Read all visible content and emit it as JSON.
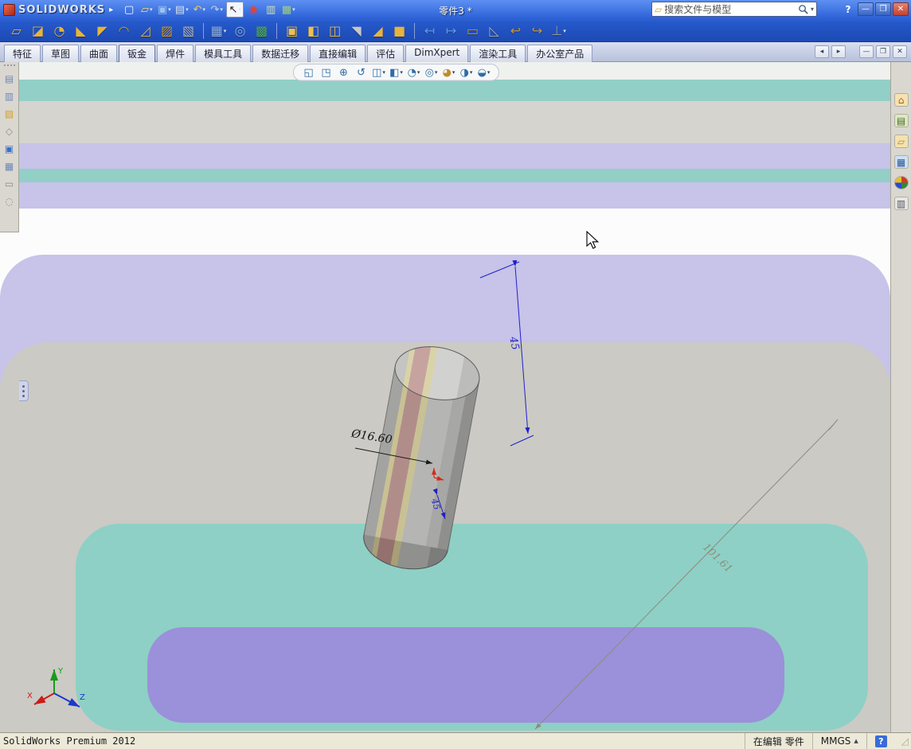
{
  "icons": {
    "dropdown": "▾",
    "chevron_right": "▸",
    "caret_up": "▲",
    "folder": "▱",
    "grip": "◿"
  },
  "window": {
    "brand": "SOLIDWORKS",
    "title": "零件3 *",
    "search_placeholder": "搜索文件与模型",
    "controls": {
      "help": "?",
      "minimize": "—",
      "maximize": "❐",
      "close": "✕"
    }
  },
  "titlebar_tools": [
    {
      "name": "new-document",
      "glyph": "▢",
      "color": "#ffffff"
    },
    {
      "name": "open-document",
      "glyph": "▱",
      "color": "#ffd86b",
      "dd": true
    },
    {
      "name": "save",
      "glyph": "▣",
      "color": "#9cc3f0",
      "dd": true
    },
    {
      "name": "print",
      "glyph": "▤",
      "color": "#d8e0ec",
      "dd": true
    },
    {
      "name": "undo",
      "glyph": "↶",
      "color": "#f6c94c",
      "dd": true
    },
    {
      "name": "redo",
      "glyph": "↷",
      "color": "#c9ced8",
      "dd": true
    },
    {
      "name": "select-tool",
      "glyph": "↖",
      "color": "#222222",
      "boxed": true,
      "dd": true
    },
    {
      "name": "rebuild",
      "glyph": "◉",
      "color": "#e04338"
    },
    {
      "name": "file-properties",
      "glyph": "▥",
      "color": "#cfe0b8"
    },
    {
      "name": "table",
      "glyph": "▦",
      "color": "#9fd089",
      "dd": true
    }
  ],
  "sheet_metal_tools": [
    {
      "name": "base-flange",
      "glyph": "▱",
      "color": "#e8b33c"
    },
    {
      "name": "convert-to-sheet-metal",
      "glyph": "◪",
      "color": "#e8b33c"
    },
    {
      "name": "lofted-bend",
      "glyph": "◔",
      "color": "#e8b33c"
    },
    {
      "name": "edge-flange",
      "glyph": "◣",
      "color": "#e8b33c"
    },
    {
      "name": "miter-flange",
      "glyph": "◤",
      "color": "#e8b33c"
    },
    {
      "name": "hem",
      "glyph": "◠",
      "color": "#cf952a"
    },
    {
      "name": "jog",
      "glyph": "◿",
      "color": "#e8b33c"
    },
    {
      "name": "sketched-bend",
      "glyph": "▨",
      "color": "#cf952a"
    },
    {
      "name": "cross-break",
      "glyph": "▧",
      "color": "#b8b8b8"
    },
    {
      "sep": true
    },
    {
      "name": "extruded-cut",
      "glyph": "▦",
      "color": "#8fb0e0",
      "dd": true
    },
    {
      "name": "simple-hole",
      "glyph": "◎",
      "color": "#8fb0e0"
    },
    {
      "name": "vent",
      "glyph": "▩",
      "color": "#54a854"
    },
    {
      "sep": true
    },
    {
      "name": "forming-tool",
      "glyph": "▣",
      "color": "#f0c04a"
    },
    {
      "name": "gusset",
      "glyph": "◧",
      "color": "#f0c04a"
    },
    {
      "name": "corner-relief",
      "glyph": "◫",
      "color": "#f0c04a"
    },
    {
      "name": "welded-corner",
      "glyph": "◥",
      "color": "#c8c8c8"
    },
    {
      "name": "break-corner",
      "glyph": "◢",
      "color": "#e8b33c"
    },
    {
      "name": "closed-corner",
      "glyph": "■",
      "color": "#e8b33c"
    },
    {
      "sep": true
    },
    {
      "name": "unfold",
      "glyph": "↤",
      "color": "#6a96e0"
    },
    {
      "name": "fold",
      "glyph": "↦",
      "color": "#6a96e0"
    },
    {
      "name": "flatten",
      "glyph": "▭",
      "color": "#cf952a"
    },
    {
      "name": "rip",
      "glyph": "◺",
      "color": "#aaaaaa"
    },
    {
      "name": "insert-bends",
      "glyph": "↩",
      "color": "#cf952a"
    },
    {
      "name": "no-bends",
      "glyph": "↪",
      "color": "#cf952a"
    },
    {
      "name": "normal-cut",
      "glyph": "⊥",
      "color": "#999999",
      "dd": true
    }
  ],
  "tabs": {
    "items": [
      "特征",
      "草图",
      "曲面",
      "钣金",
      "焊件",
      "模具工具",
      "数据迁移",
      "直接编辑",
      "评估",
      "DimXpert",
      "渲染工具",
      "办公室产品"
    ],
    "active_index": 3
  },
  "tab_controls": [
    {
      "name": "pane-scroll-left",
      "glyph": "◂"
    },
    {
      "name": "pane-scroll-right",
      "glyph": "▸"
    },
    {
      "name": "document-minimize",
      "glyph": "—"
    },
    {
      "name": "document-restore",
      "glyph": "❐"
    },
    {
      "name": "document-close",
      "glyph": "✕"
    }
  ],
  "left_tools": [
    {
      "name": "left-toolbar-tool-1",
      "glyph": "▤",
      "color": "#6f87b8"
    },
    {
      "name": "left-toolbar-tool-2",
      "glyph": "▥",
      "color": "#6f87b8"
    },
    {
      "name": "left-toolbar-tool-3",
      "glyph": "▨",
      "color": "#cfa12c"
    },
    {
      "name": "left-toolbar-tool-4",
      "glyph": "◇",
      "color": "#8a8a8a"
    },
    {
      "name": "left-toolbar-tool-5",
      "glyph": "▣",
      "color": "#3a6ec8"
    },
    {
      "name": "left-toolbar-tool-6",
      "glyph": "▦",
      "color": "#6f87b8"
    },
    {
      "name": "left-toolbar-tool-7",
      "glyph": "▭",
      "color": "#8a8a8a"
    },
    {
      "name": "left-toolbar-tool-8",
      "glyph": "◌",
      "color": "#8a8a8a"
    }
  ],
  "headsup_tools": [
    {
      "name": "zoom-to-fit",
      "glyph": "◱",
      "color": "#2d6da8"
    },
    {
      "name": "zoom-to-area",
      "glyph": "◳",
      "color": "#2d6da8"
    },
    {
      "name": "zoom-in-out",
      "glyph": "⊕",
      "color": "#2d6da8"
    },
    {
      "name": "rotate-view",
      "glyph": "↺",
      "color": "#2d6da8"
    },
    {
      "name": "section-view",
      "glyph": "◫",
      "color": "#2d6da8",
      "dd": true
    },
    {
      "name": "view-orientation",
      "glyph": "◧",
      "color": "#2d6da8",
      "dd": true
    },
    {
      "name": "display-style",
      "glyph": "◔",
      "color": "#2d6da8",
      "dd": true
    },
    {
      "name": "hide-show-items",
      "glyph": "◎",
      "color": "#2d6da8",
      "dd": true
    },
    {
      "name": "edit-appearance",
      "glyph": "◕",
      "color": "#c08a2a",
      "dd": true
    },
    {
      "name": "apply-scene",
      "glyph": "◑",
      "color": "#2d6da8",
      "dd": true
    },
    {
      "name": "view-settings",
      "glyph": "◒",
      "color": "#2d6da8",
      "dd": true
    }
  ],
  "taskpane_tools": [
    {
      "name": "solidworks-resources",
      "glyph": "⌂",
      "color": "#b35c1e",
      "bg": "#f4e2b0"
    },
    {
      "name": "design-library",
      "glyph": "▤",
      "color": "#4a6a2a",
      "bg": "#dde8c0"
    },
    {
      "name": "file-explorer",
      "glyph": "▱",
      "color": "#b08a1e",
      "bg": "#f4e2b0"
    },
    {
      "name": "view-palette",
      "glyph": "▦",
      "color": "#2a5a9a",
      "bg": "#cfe0f4"
    },
    {
      "name": "appearances-scenes",
      "glyph": "",
      "bg": "conic-gradient(#d03a2a 0 25%, #2a8a3a 25% 50%, #2a4ad0 50% 75%, #e8c02a 75%)",
      "round": true
    },
    {
      "name": "custom-properties",
      "glyph": "▥",
      "color": "#555555",
      "bg": "#e6e6e6"
    }
  ],
  "viewport_annotations": {
    "diameter_dim": "Ø16.60",
    "height_dim": "45",
    "bottom_dim": "45",
    "floor_dim": "101.61",
    "triad": {
      "x": "X",
      "y": "Y",
      "z": "Z"
    }
  },
  "statusbar": {
    "product": "SolidWorks Premium 2012",
    "editing": "在编辑 零件",
    "units": "MMGS",
    "help": "?"
  }
}
